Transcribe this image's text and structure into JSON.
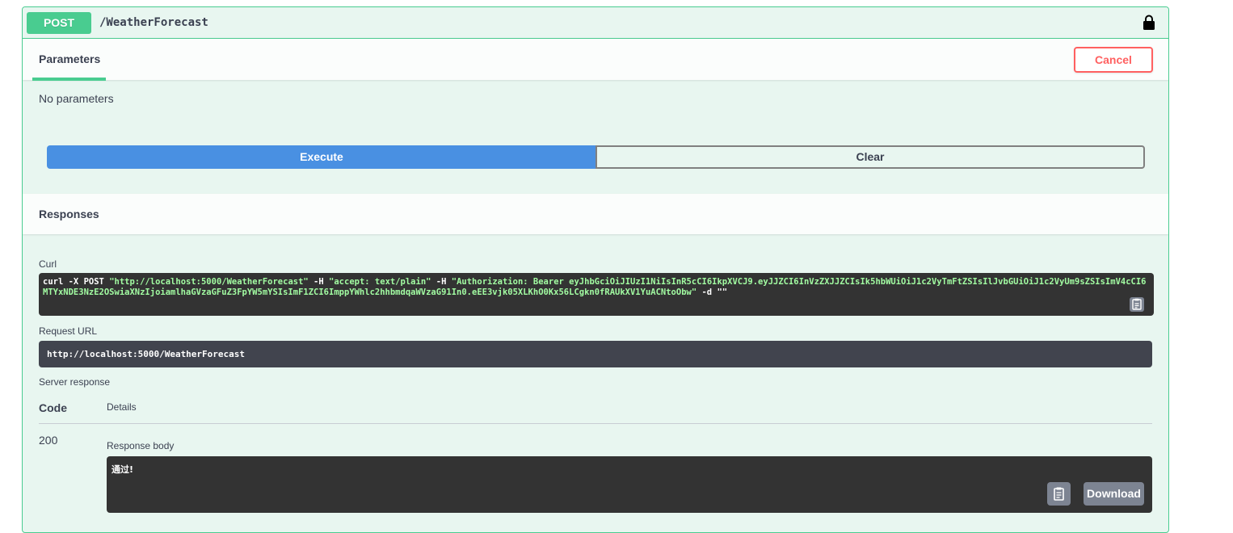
{
  "operation": {
    "method": "POST",
    "path": "/WeatherForecast"
  },
  "parameters": {
    "tab_label": "Parameters",
    "cancel_label": "Cancel",
    "empty_text": "No parameters"
  },
  "actions": {
    "execute_label": "Execute",
    "clear_label": "Clear"
  },
  "responses": {
    "title": "Responses",
    "curl_label": "Curl",
    "curl_prefix": "curl -X POST ",
    "curl_url": "\"http://localhost:5000/WeatherForecast\"",
    "curl_h1": " -H  ",
    "curl_accept": "\"accept: text/plain\"",
    "curl_h2": " -H  ",
    "curl_auth": "\"Authorization: Bearer eyJhbGciOiJIUzI1NiIsInR5cCI6IkpXVCJ9.eyJJZCI6InVzZXJJZCIsIk5hbWUiOiJ1c2VyTmFtZSIsIlJvbGUiOiJ1c2VyUm9sZSIsImV4cCI6MTYxNDE3NzE2OSwiaXNzIjoiamlhaGVzaGFuZ3FpYW5mYSIsImF1ZCI6ImppYWhlc2hhbmdqaWVzaG91In0.eEE3vjk05XLKhO0Kx56LCgkn0fRAUkXV1YuACNtoObw\"",
    "curl_suffix": " -d \"\"",
    "request_url_label": "Request URL",
    "request_url": "http://localhost:5000/WeatherForecast",
    "server_response_label": "Server response",
    "col_code": "Code",
    "col_details": "Details",
    "status_code": "200",
    "response_body_label": "Response body",
    "response_body": "通过!",
    "download_label": "Download"
  }
}
